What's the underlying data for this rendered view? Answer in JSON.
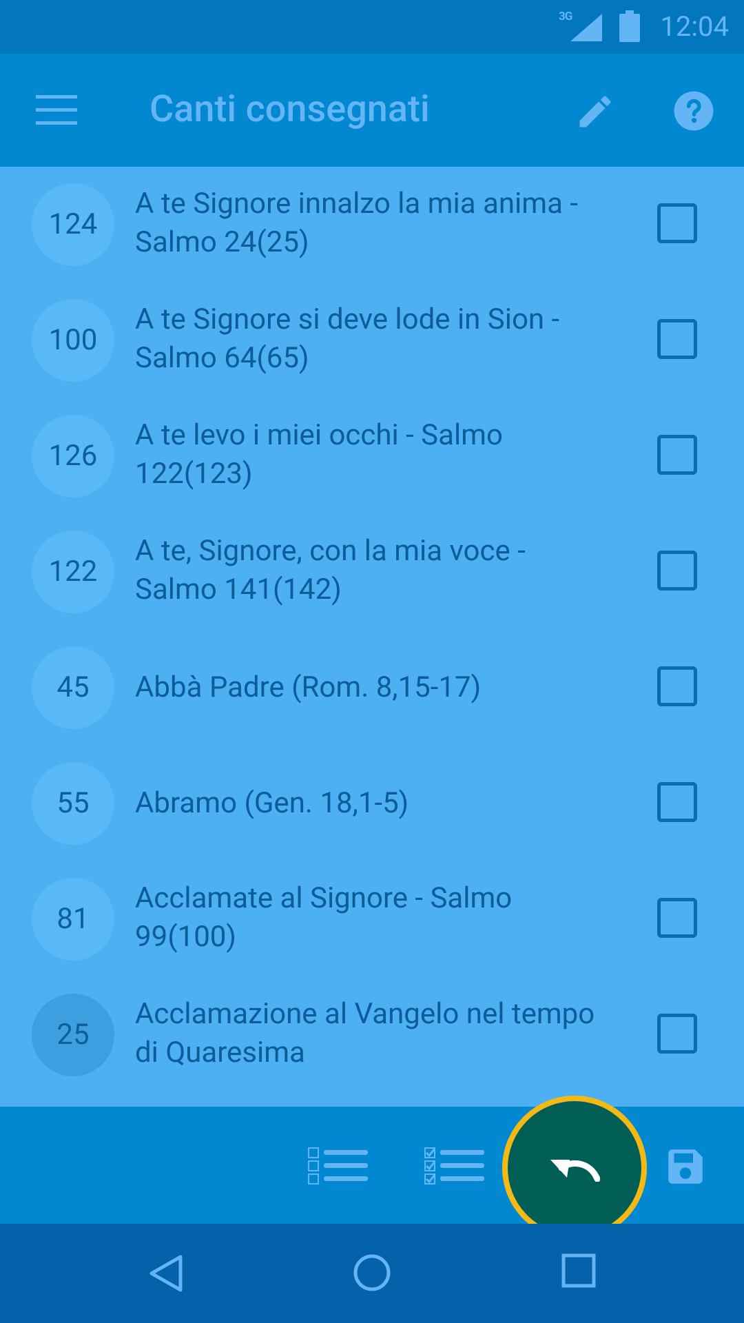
{
  "status_bar": {
    "network": "3G",
    "time": "12:04"
  },
  "app_bar": {
    "title": "Canti consegnati"
  },
  "songs": [
    {
      "number": "124",
      "title": "A te Signore innalzo la mia anima - Salmo 24(25)"
    },
    {
      "number": "100",
      "title": "A te Signore si deve lode in Sion - Salmo 64(65)"
    },
    {
      "number": "126",
      "title": "A te levo i miei occhi - Salmo 122(123)"
    },
    {
      "number": "122",
      "title": "A te, Signore, con la mia voce - Salmo 141(142)"
    },
    {
      "number": "45",
      "title": "Abbà Padre (Rom. 8,15-17)"
    },
    {
      "number": "55",
      "title": "Abramo (Gen. 18,1-5)"
    },
    {
      "number": "81",
      "title": "Acclamate al Signore - Salmo 99(100)"
    },
    {
      "number": "25",
      "title": "Acclamazione al Vangelo nel tempo di Quaresima"
    }
  ],
  "bottom_actions": [
    "list-icon",
    "checklist-icon",
    "undo-icon",
    "save-icon"
  ],
  "colors": {
    "status_bar": "#0277bd",
    "app_bar": "#0288d1",
    "list_background": "#4db0f3",
    "fab": "#005e54",
    "highlight_ring": "#f5b916",
    "nav_bar": "#0362a9"
  }
}
